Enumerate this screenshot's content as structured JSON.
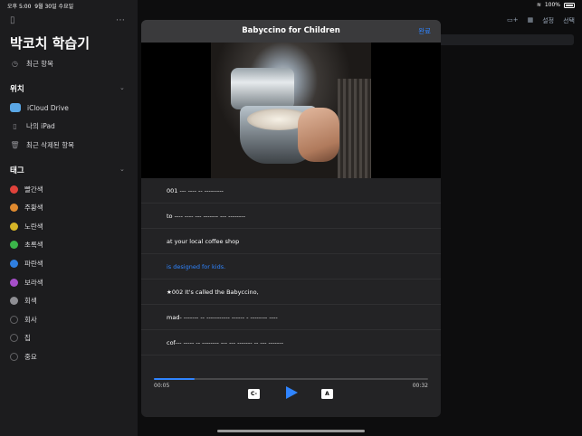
{
  "status_bar": {
    "time": "오후 5:00",
    "date": "9월 30일 수요일",
    "battery": "100%"
  },
  "sidebar": {
    "title": "박코치 학습기",
    "recent": "최근 항목",
    "location_header": "위치",
    "locations": [
      {
        "label": "iCloud Drive"
      },
      {
        "label": "나의 iPad"
      },
      {
        "label": "최근 삭제된 항목"
      }
    ],
    "tags_header": "태그",
    "tags": [
      {
        "label": "빨간색",
        "color": "#e0423b"
      },
      {
        "label": "주황색",
        "color": "#e08a2f"
      },
      {
        "label": "노란색",
        "color": "#d6b527"
      },
      {
        "label": "초록색",
        "color": "#3bb54a"
      },
      {
        "label": "파란색",
        "color": "#2f7fe0"
      },
      {
        "label": "보라색",
        "color": "#a64fc9"
      },
      {
        "label": "회색",
        "color": "#8e8e93"
      },
      {
        "label": "회사",
        "color": ""
      },
      {
        "label": "집",
        "color": ""
      },
      {
        "label": "중요",
        "color": ""
      }
    ]
  },
  "toolbar": {
    "settings": "설정",
    "select": "선택"
  },
  "modal": {
    "title": "Babyccino for Children",
    "done": "완료",
    "subtitles": [
      {
        "text": "001 --- ---- -- ---------",
        "active": false
      },
      {
        "text": "to ---- ---- --- ------- --- --------",
        "active": false
      },
      {
        "text": "at your local coffee shop",
        "active": false
      },
      {
        "text": "is designed for kids.",
        "active": true
      },
      {
        "text": "★002 It's called the Babyccino,",
        "active": false
      },
      {
        "text": "mad- ------- -- ----------- ------ - -------- ----",
        "active": false
      },
      {
        "text": "cof--- ----- -- -------- --- --- ------- -- --- -------",
        "active": false
      }
    ],
    "progress": 0.15,
    "time_current": "00:05",
    "time_total": "00:32",
    "left_control": "C-",
    "right_control": "A"
  }
}
